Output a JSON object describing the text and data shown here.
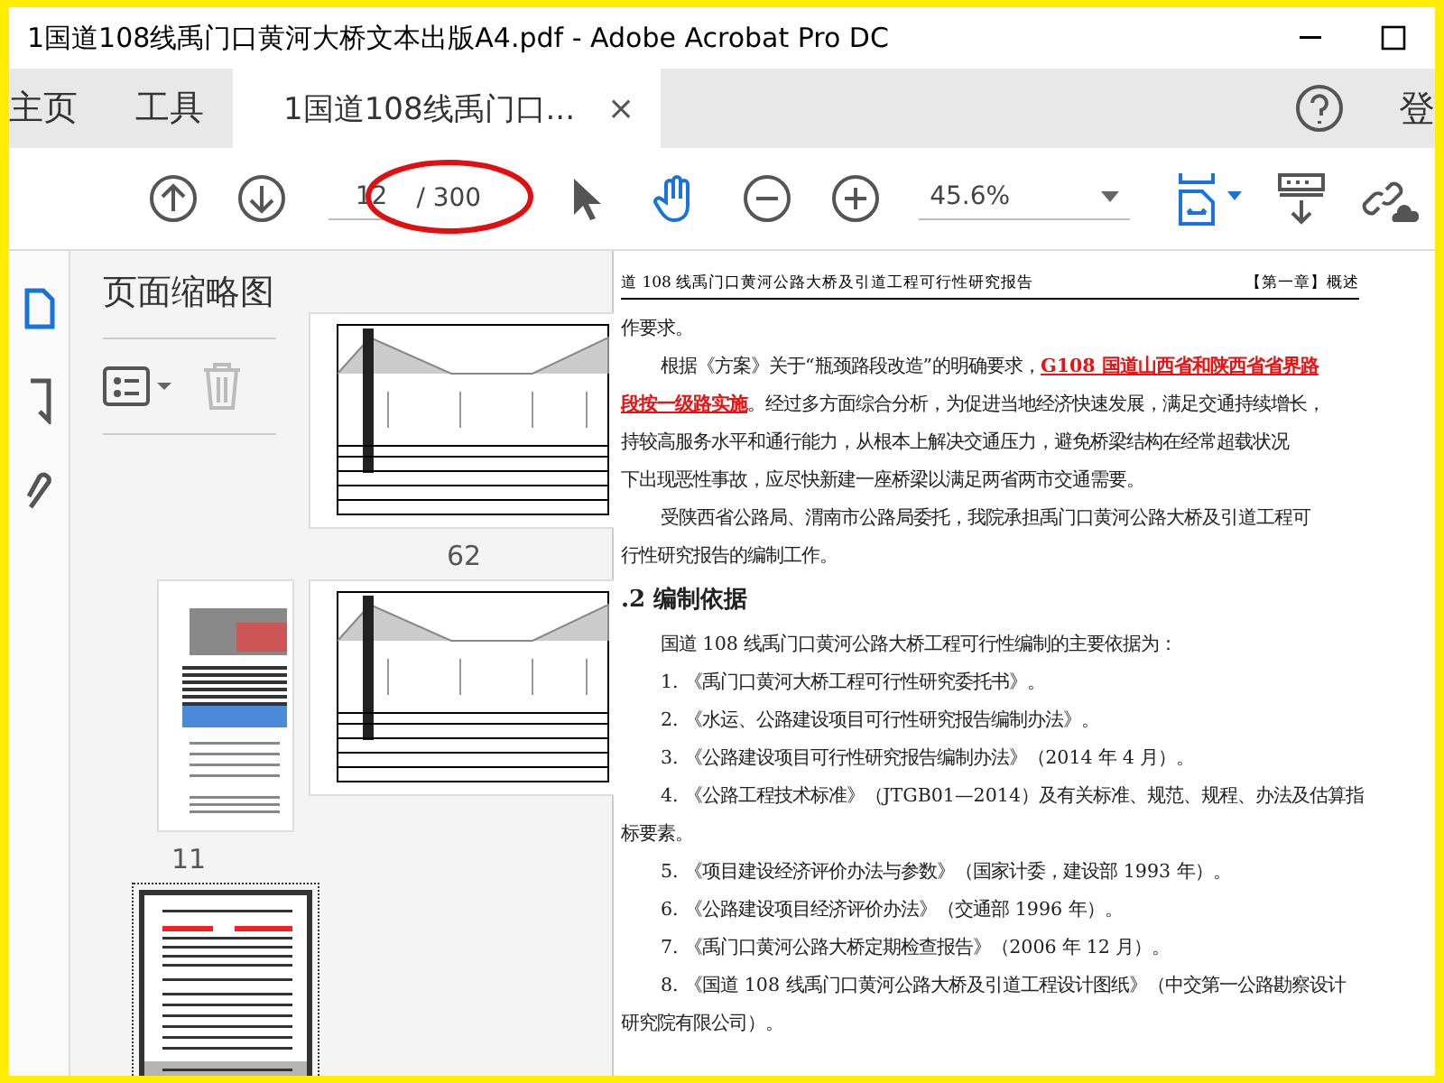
{
  "window": {
    "title": "1国道108线禹门口黄河大桥文本出版A4.pdf - Adobe Acrobat Pro DC"
  },
  "tabs": [
    {
      "label": "主页",
      "kind": "nav",
      "selected": false
    },
    {
      "label": "工具",
      "kind": "nav",
      "selected": false
    },
    {
      "label": "1国道108线禹门口...",
      "kind": "document",
      "selected": true,
      "close": "×"
    }
  ],
  "account": {
    "label": "登"
  },
  "toolbar": {
    "page": "12",
    "total": "/ 300",
    "zoom": "45.6%",
    "tools": [
      {
        "kind": "select",
        "selected": false
      },
      {
        "kind": "hand",
        "selected": true
      }
    ]
  },
  "sidebar": {
    "items": [
      {
        "kind": "page",
        "selected": true
      },
      {
        "kind": "bookmark",
        "selected": false
      },
      {
        "kind": "attachment",
        "selected": false
      }
    ]
  },
  "thumbnails": {
    "title": "页面缩略图",
    "items": [
      {
        "kind": "drawing",
        "label": "62",
        "selected": false
      },
      {
        "kind": "report",
        "label": "11",
        "selected": false
      },
      {
        "kind": "drawing",
        "selected": false
      },
      {
        "kind": "text",
        "selected": true
      }
    ]
  },
  "document": {
    "header": "道 108 线禹门口黄河公路大桥及引道工程可行性研究报告",
    "chapter": "【第一章】概述",
    "lines": [
      {
        "kind": "line",
        "indent": false,
        "segments": [
          {
            "text": "作要求。",
            "highlight": false
          }
        ]
      },
      {
        "kind": "line",
        "indent": true,
        "segments": [
          {
            "text": "根据《方案》关于“瓶颈路段改造”的明确要求，",
            "highlight": false
          },
          {
            "text": "G108 国道山西省和陕西省省界路",
            "highlight": true
          }
        ]
      },
      {
        "kind": "line",
        "indent": false,
        "segments": [
          {
            "text": "段按一级路实施",
            "highlight": true
          },
          {
            "text": "。经过多方面综合分析，为促进当地经济快速发展，满足交通持续增长，",
            "highlight": false
          }
        ]
      },
      {
        "kind": "line",
        "indent": false,
        "segments": [
          {
            "text": "持较高服务水平和通行能力，从根本上解决交通压力，避免桥梁结构在经常超载状况",
            "highlight": false
          }
        ]
      },
      {
        "kind": "line",
        "indent": false,
        "segments": [
          {
            "text": "下出现恶性事故，应尽快新建一座桥梁以满足两省两市交通需要。",
            "highlight": false
          }
        ]
      },
      {
        "kind": "line",
        "indent": true,
        "segments": [
          {
            "text": "受陕西省公路局、渭南市公路局委托，我院承担禹门口黄河公路大桥及引道工程可",
            "highlight": false
          }
        ]
      },
      {
        "kind": "line",
        "indent": false,
        "segments": [
          {
            "text": "行性研究报告的编制工作。",
            "highlight": false
          }
        ]
      },
      {
        "kind": "heading",
        "indent": false,
        "segments": [
          {
            "text": ".2 编制依据",
            "highlight": false
          }
        ]
      },
      {
        "kind": "line",
        "indent": true,
        "segments": [
          {
            "text": "国道 108 线禹门口黄河公路大桥工程可行性编制的主要依据为：",
            "highlight": false
          }
        ]
      },
      {
        "kind": "line",
        "indent": true,
        "segments": [
          {
            "text": "1. 《禹门口黄河大桥工程可行性研究委托书》。",
            "highlight": false
          }
        ]
      },
      {
        "kind": "line",
        "indent": true,
        "segments": [
          {
            "text": "2. 《水运、公路建设项目可行性研究报告编制办法》。",
            "highlight": false
          }
        ]
      },
      {
        "kind": "line",
        "indent": true,
        "segments": [
          {
            "text": "3. 《公路建设项目可行性研究报告编制办法》（2014 年 4 月）。",
            "highlight": false
          }
        ]
      },
      {
        "kind": "line",
        "indent": true,
        "segments": [
          {
            "text": "4. 《公路工程技术标准》（JTGB01—2014）及有关标准、规范、规程、办法及估算指",
            "highlight": false
          }
        ]
      },
      {
        "kind": "line",
        "indent": false,
        "segments": [
          {
            "text": "标要素。",
            "highlight": false
          }
        ]
      },
      {
        "kind": "line",
        "indent": true,
        "segments": [
          {
            "text": "5. 《项目建设经济评价办法与参数》（国家计委，建设部 1993 年）。",
            "highlight": false
          }
        ]
      },
      {
        "kind": "line",
        "indent": true,
        "segments": [
          {
            "text": "6. 《公路建设项目经济评价办法》（交通部 1996 年）。",
            "highlight": false
          }
        ]
      },
      {
        "kind": "line",
        "indent": true,
        "segments": [
          {
            "text": "7. 《禹门口黄河公路大桥定期检查报告》（2006 年 12 月）。",
            "highlight": false
          }
        ]
      },
      {
        "kind": "line",
        "indent": true,
        "segments": [
          {
            "text": "8. 《国道 108 线禹门口黄河公路大桥及引道工程设计图纸》（中交第一公路勘察设计",
            "highlight": false
          }
        ]
      },
      {
        "kind": "line",
        "indent": false,
        "segments": [
          {
            "text": "研究院有限公司）。",
            "highlight": false
          }
        ]
      }
    ]
  }
}
